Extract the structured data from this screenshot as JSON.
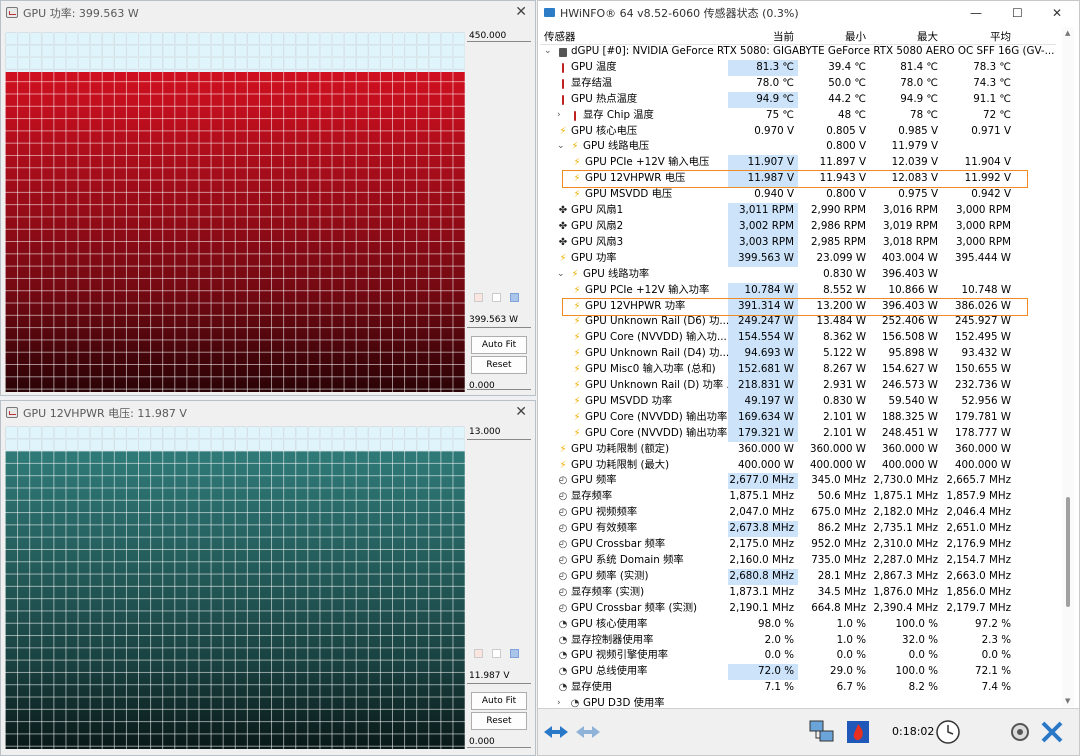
{
  "power_window": {
    "title": "GPU 功率: 399.563 W",
    "axis_max": "450.000",
    "current_label": "399.563 W",
    "axis_min": "0.000",
    "auto_fit": "Auto Fit",
    "reset": "Reset",
    "fill_fraction": 0.888,
    "color": "#d01020"
  },
  "voltage_window": {
    "title": "GPU 12VHPWR 电压: 11.987 V",
    "axis_max": "13.000",
    "current_label": "11.987 V",
    "axis_min": "0.000",
    "auto_fit": "Auto Fit",
    "reset": "Reset",
    "fill_fraction": 0.922,
    "color": "#2f7a78"
  },
  "hwinfo": {
    "title": "HWiNFO® 64 v8.52-6060 传感器状态 (0.3%)",
    "columns": [
      "传感器",
      "当前",
      "最小",
      "最大",
      "平均"
    ],
    "device": "dGPU [#0]: NVIDIA GeForce RTX 5080: GIGABYTE GeForce RTX 5080 AERO OC SFF 16G (GV-...",
    "uptime": "0:18:02",
    "rows": [
      {
        "name": "GPU 温度",
        "icon": "thermometer-icon",
        "cur": "81.3 ℃",
        "min": "39.4 ℃",
        "max": "81.4 ℃",
        "avg": "78.3 ℃",
        "level": 1,
        "hl": true
      },
      {
        "name": "显存结温",
        "icon": "thermometer-icon",
        "cur": "78.0 ℃",
        "min": "50.0 ℃",
        "max": "78.0 ℃",
        "avg": "74.3 ℃",
        "level": 1,
        "hl": false
      },
      {
        "name": "GPU 热点温度",
        "icon": "thermometer-icon",
        "cur": "94.9 ℃",
        "min": "44.2 ℃",
        "max": "94.9 ℃",
        "avg": "91.1 ℃",
        "level": 1,
        "hl": true
      },
      {
        "name": "显存 Chip 温度",
        "icon": "thermometer-icon",
        "cur": "75 ℃",
        "min": "48 ℃",
        "max": "78 ℃",
        "avg": "72 ℃",
        "level": 1,
        "hl": false,
        "expand": "›"
      },
      {
        "name": "GPU 核心电压",
        "icon": "lightning-icon",
        "cur": "0.970 V",
        "min": "0.805 V",
        "max": "0.985 V",
        "avg": "0.971 V",
        "level": 1,
        "hl": false
      },
      {
        "name": "GPU 线路电压",
        "icon": "lightning-icon",
        "cur": "",
        "min": "0.800 V",
        "max": "11.979 V",
        "avg": "",
        "level": 1,
        "hl": false,
        "expand": "⌄"
      },
      {
        "name": "GPU PCIe +12V 输入电压",
        "icon": "lightning-icon",
        "cur": "11.907 V",
        "min": "11.897 V",
        "max": "12.039 V",
        "avg": "11.904 V",
        "level": 2,
        "hl": true
      },
      {
        "name": "GPU 12VHPWR 电压",
        "icon": "lightning-icon",
        "cur": "11.987 V",
        "min": "11.943 V",
        "max": "12.083 V",
        "avg": "11.992 V",
        "level": 2,
        "hl": true
      },
      {
        "name": "GPU MSVDD 电压",
        "icon": "lightning-icon",
        "cur": "0.940 V",
        "min": "0.800 V",
        "max": "0.975 V",
        "avg": "0.942 V",
        "level": 2,
        "hl": false
      },
      {
        "name": "GPU 风扇1",
        "icon": "fan-icon",
        "cur": "3,011 RPM",
        "min": "2,990 RPM",
        "max": "3,016 RPM",
        "avg": "3,000 RPM",
        "level": 1,
        "hl": true
      },
      {
        "name": "GPU 风扇2",
        "icon": "fan-icon",
        "cur": "3,002 RPM",
        "min": "2,986 RPM",
        "max": "3,019 RPM",
        "avg": "3,000 RPM",
        "level": 1,
        "hl": true
      },
      {
        "name": "GPU 风扇3",
        "icon": "fan-icon",
        "cur": "3,003 RPM",
        "min": "2,985 RPM",
        "max": "3,018 RPM",
        "avg": "3,000 RPM",
        "level": 1,
        "hl": true
      },
      {
        "name": "GPU 功率",
        "icon": "lightning-icon",
        "cur": "399.563 W",
        "min": "23.099 W",
        "max": "403.004 W",
        "avg": "395.444 W",
        "level": 1,
        "hl": true
      },
      {
        "name": "GPU 线路功率",
        "icon": "lightning-icon",
        "cur": "",
        "min": "0.830 W",
        "max": "396.403 W",
        "avg": "",
        "level": 1,
        "hl": false,
        "expand": "⌄"
      },
      {
        "name": "GPU PCIe +12V 输入功率",
        "icon": "lightning-icon",
        "cur": "10.784 W",
        "min": "8.552 W",
        "max": "10.866 W",
        "avg": "10.748 W",
        "level": 2,
        "hl": true
      },
      {
        "name": "GPU 12VHPWR 功率",
        "icon": "lightning-icon",
        "cur": "391.314 W",
        "min": "13.200 W",
        "max": "396.403 W",
        "avg": "386.026 W",
        "level": 2,
        "hl": true
      },
      {
        "name": "GPU Unknown Rail (D6) 功...",
        "icon": "lightning-icon",
        "cur": "249.247 W",
        "min": "13.484 W",
        "max": "252.406 W",
        "avg": "245.927 W",
        "level": 2,
        "hl": true
      },
      {
        "name": "GPU Core (NVVDD) 输入功...",
        "icon": "lightning-icon",
        "cur": "154.554 W",
        "min": "8.362 W",
        "max": "156.508 W",
        "avg": "152.495 W",
        "level": 2,
        "hl": true
      },
      {
        "name": "GPU Unknown Rail (D4) 功...",
        "icon": "lightning-icon",
        "cur": "94.693 W",
        "min": "5.122 W",
        "max": "95.898 W",
        "avg": "93.432 W",
        "level": 2,
        "hl": true
      },
      {
        "name": "GPU Misc0 输入功率 (总和)",
        "icon": "lightning-icon",
        "cur": "152.681 W",
        "min": "8.267 W",
        "max": "154.627 W",
        "avg": "150.655 W",
        "level": 2,
        "hl": true
      },
      {
        "name": "GPU Unknown Rail (D) 功率 ...",
        "icon": "lightning-icon",
        "cur": "218.831 W",
        "min": "2.931 W",
        "max": "246.573 W",
        "avg": "232.736 W",
        "level": 2,
        "hl": true
      },
      {
        "name": "GPU MSVDD 功率",
        "icon": "lightning-icon",
        "cur": "49.197 W",
        "min": "0.830 W",
        "max": "59.540 W",
        "avg": "52.956 W",
        "level": 2,
        "hl": true
      },
      {
        "name": "GPU Core (NVVDD) 输出功率",
        "icon": "lightning-icon",
        "cur": "169.634 W",
        "min": "2.101 W",
        "max": "188.325 W",
        "avg": "179.781 W",
        "level": 2,
        "hl": true
      },
      {
        "name": "GPU Core (NVVDD) 输出功率",
        "icon": "lightning-icon",
        "cur": "179.321 W",
        "min": "2.101 W",
        "max": "248.451 W",
        "avg": "178.777 W",
        "level": 2,
        "hl": true
      },
      {
        "name": "GPU 功耗限制 (额定)",
        "icon": "lightning-icon",
        "cur": "360.000 W",
        "min": "360.000 W",
        "max": "360.000 W",
        "avg": "360.000 W",
        "level": 1,
        "hl": false
      },
      {
        "name": "GPU 功耗限制 (最大)",
        "icon": "lightning-icon",
        "cur": "400.000 W",
        "min": "400.000 W",
        "max": "400.000 W",
        "avg": "400.000 W",
        "level": 1,
        "hl": false
      },
      {
        "name": "GPU 频率",
        "icon": "clock-icon",
        "cur": "2,677.0 MHz",
        "min": "345.0 MHz",
        "max": "2,730.0 MHz",
        "avg": "2,665.7 MHz",
        "level": 1,
        "hl": true
      },
      {
        "name": "显存频率",
        "icon": "clock-icon",
        "cur": "1,875.1 MHz",
        "min": "50.6 MHz",
        "max": "1,875.1 MHz",
        "avg": "1,857.9 MHz",
        "level": 1,
        "hl": false
      },
      {
        "name": "GPU 视频频率",
        "icon": "clock-icon",
        "cur": "2,047.0 MHz",
        "min": "675.0 MHz",
        "max": "2,182.0 MHz",
        "avg": "2,046.4 MHz",
        "level": 1,
        "hl": false
      },
      {
        "name": "GPU 有效频率",
        "icon": "clock-icon",
        "cur": "2,673.8 MHz",
        "min": "86.2 MHz",
        "max": "2,735.1 MHz",
        "avg": "2,651.0 MHz",
        "level": 1,
        "hl": true
      },
      {
        "name": "GPU Crossbar 频率",
        "icon": "clock-icon",
        "cur": "2,175.0 MHz",
        "min": "952.0 MHz",
        "max": "2,310.0 MHz",
        "avg": "2,176.9 MHz",
        "level": 1,
        "hl": false
      },
      {
        "name": "GPU 系统 Domain 频率",
        "icon": "clock-icon",
        "cur": "2,160.0 MHz",
        "min": "735.0 MHz",
        "max": "2,287.0 MHz",
        "avg": "2,154.7 MHz",
        "level": 1,
        "hl": false
      },
      {
        "name": "GPU 频率 (实测)",
        "icon": "clock-icon",
        "cur": "2,680.8 MHz",
        "min": "28.1 MHz",
        "max": "2,867.3 MHz",
        "avg": "2,663.0 MHz",
        "level": 1,
        "hl": true
      },
      {
        "name": "显存频率 (实测)",
        "icon": "clock-icon",
        "cur": "1,873.1 MHz",
        "min": "34.5 MHz",
        "max": "1,876.0 MHz",
        "avg": "1,856.0 MHz",
        "level": 1,
        "hl": false
      },
      {
        "name": "GPU Crossbar 频率 (实测)",
        "icon": "clock-icon",
        "cur": "2,190.1 MHz",
        "min": "664.8 MHz",
        "max": "2,390.4 MHz",
        "avg": "2,179.7 MHz",
        "level": 1,
        "hl": false
      },
      {
        "name": "GPU 核心使用率",
        "icon": "usage-icon",
        "cur": "98.0 %",
        "min": "1.0 %",
        "max": "100.0 %",
        "avg": "97.2 %",
        "level": 1,
        "hl": false
      },
      {
        "name": "显存控制器使用率",
        "icon": "usage-icon",
        "cur": "2.0 %",
        "min": "1.0 %",
        "max": "32.0 %",
        "avg": "2.3 %",
        "level": 1,
        "hl": false
      },
      {
        "name": "GPU 视频引擎使用率",
        "icon": "usage-icon",
        "cur": "0.0 %",
        "min": "0.0 %",
        "max": "0.0 %",
        "avg": "0.0 %",
        "level": 1,
        "hl": false
      },
      {
        "name": "GPU 总线使用率",
        "icon": "usage-icon",
        "cur": "72.0 %",
        "min": "29.0 %",
        "max": "100.0 %",
        "avg": "72.1 %",
        "level": 1,
        "hl": true
      },
      {
        "name": "显存使用",
        "icon": "usage-icon",
        "cur": "7.1 %",
        "min": "6.7 %",
        "max": "8.2 %",
        "avg": "7.4 %",
        "level": 1,
        "hl": false
      },
      {
        "name": "GPU D3D 使用率",
        "icon": "usage-icon",
        "cur": "",
        "min": "",
        "max": "",
        "avg": "",
        "level": 1,
        "hl": false,
        "expand": "›"
      }
    ],
    "highlighted_rows": [
      7,
      15
    ]
  }
}
